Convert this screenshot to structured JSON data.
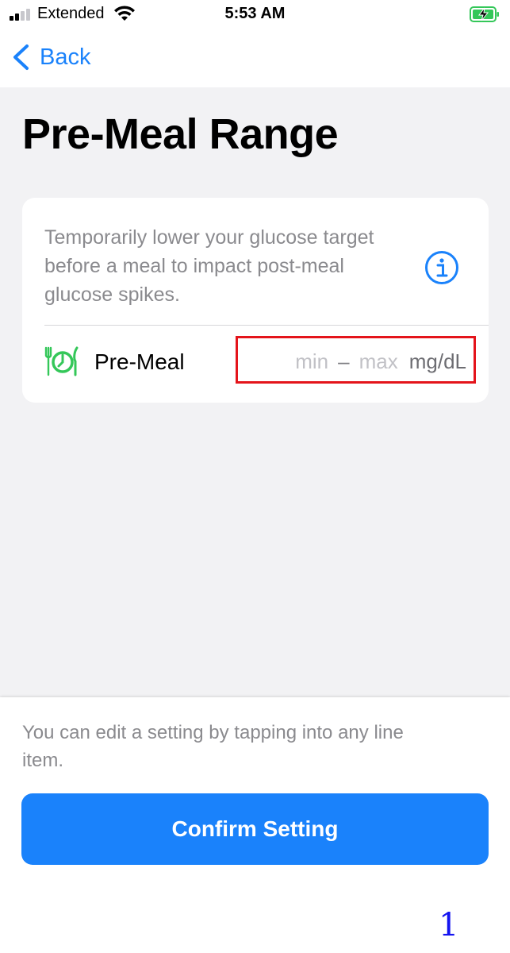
{
  "status_bar": {
    "carrier": "Extended",
    "time": "5:53 AM"
  },
  "nav": {
    "back_label": "Back"
  },
  "page": {
    "title": "Pre-Meal Range"
  },
  "card": {
    "description": "Temporarily lower your glucose target before a meal to impact post-meal glucose spikes.",
    "row": {
      "label": "Pre-Meal",
      "min_placeholder": "min",
      "separator": "–",
      "max_placeholder": "max",
      "unit": "mg/dL"
    }
  },
  "footer": {
    "hint": "You can edit a setting by tapping into any line item.",
    "confirm_label": "Confirm Setting"
  },
  "annotation": {
    "page_number": "1"
  },
  "colors": {
    "accent": "#1a82fb",
    "meal_icon": "#34c759",
    "highlight_box": "#e4141b",
    "background": "#f2f2f4"
  }
}
